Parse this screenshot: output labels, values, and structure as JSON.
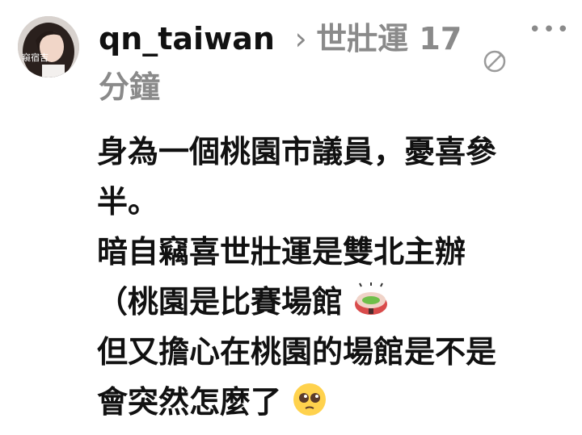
{
  "header": {
    "username": "qn_taiwan",
    "chevron_icon": "chevron-right-icon",
    "topic": "世壯運",
    "time": "17 分鐘",
    "more_icon": "more-horizontal-icon",
    "edit_icon": "edit-slash-icon"
  },
  "avatar": {
    "caption": "窺宿吉"
  },
  "post": {
    "lines": [
      "身為一個桃園市議員，憂喜參",
      "半。",
      "暗自竊喜世壯運是雙北主辦",
      "（桃園是比賽場館",
      "但又擔心在桃園的場館是不是",
      "會突然怎麼了"
    ],
    "emoji_1": "stadium-emoji",
    "emoji_2": "pleading-face-emoji"
  },
  "colors": {
    "text": "#111111",
    "muted": "#8a8a8a",
    "background": "#ffffff"
  }
}
